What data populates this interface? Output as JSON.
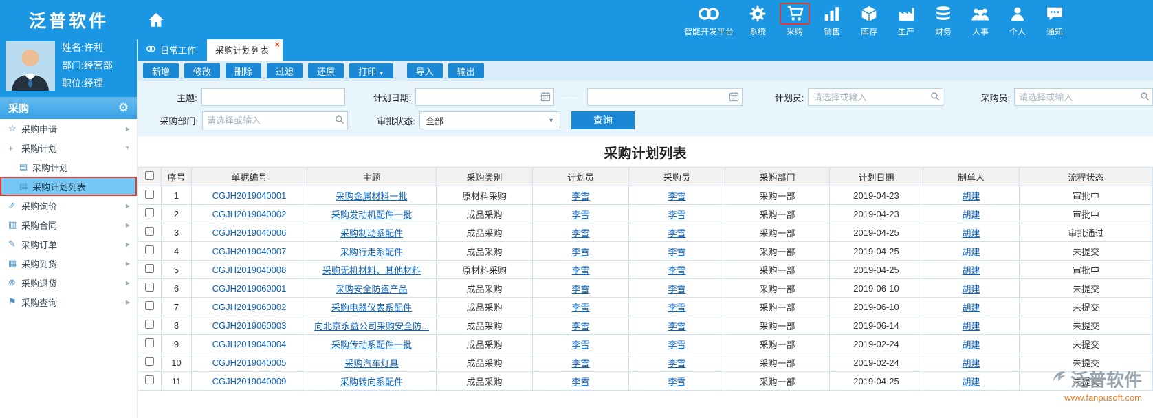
{
  "brand": {
    "logo": "泛普软件"
  },
  "topnav": {
    "items": [
      {
        "key": "dev-platform",
        "label": "智能开发平台",
        "icon": "infinity-icon",
        "highlighted": false
      },
      {
        "key": "system",
        "label": "系统",
        "icon": "gear-icon",
        "highlighted": false
      },
      {
        "key": "purchase",
        "label": "采购",
        "icon": "cart-icon",
        "highlighted": true
      },
      {
        "key": "sales",
        "label": "销售",
        "icon": "chart-icon",
        "highlighted": false
      },
      {
        "key": "inventory",
        "label": "库存",
        "icon": "inventory-icon",
        "highlighted": false
      },
      {
        "key": "production",
        "label": "生产",
        "icon": "production-icon",
        "highlighted": false
      },
      {
        "key": "finance",
        "label": "财务",
        "icon": "finance-icon",
        "highlighted": false
      },
      {
        "key": "hr",
        "label": "人事",
        "icon": "hr-icon",
        "highlighted": false
      },
      {
        "key": "personal",
        "label": "个人",
        "icon": "person-icon",
        "highlighted": false
      },
      {
        "key": "notification",
        "label": "通知",
        "icon": "notification-icon",
        "highlighted": false
      }
    ]
  },
  "profile": {
    "name": "姓名:许利",
    "department": "部门:经营部",
    "position": "职位:经理"
  },
  "sidebar": {
    "section_title": "采购",
    "items": [
      {
        "key": "purchase-request",
        "label": "采购申请",
        "icon": "star-icon",
        "level": 0,
        "arrow": "right",
        "selected": false
      },
      {
        "key": "purchase-plan",
        "label": "采购计划",
        "icon": "plus-icon",
        "level": 0,
        "arrow": "down",
        "selected": false
      },
      {
        "key": "purchase-plan-sub",
        "label": "采购计划",
        "icon": "file-icon",
        "level": 1,
        "arrow": "",
        "selected": false
      },
      {
        "key": "purchase-plan-list",
        "label": "采购计划列表",
        "icon": "file-icon",
        "level": 1,
        "arrow": "",
        "selected": true
      },
      {
        "key": "purchase-inquiry",
        "label": "采购询价",
        "icon": "share-icon",
        "level": 0,
        "arrow": "right",
        "selected": false
      },
      {
        "key": "purchase-contract",
        "label": "采购合同",
        "icon": "contract-icon",
        "level": 0,
        "arrow": "right",
        "selected": false
      },
      {
        "key": "purchase-order",
        "label": "采购订单",
        "icon": "order-icon",
        "level": 0,
        "arrow": "right",
        "selected": false
      },
      {
        "key": "purchase-arrival",
        "label": "采购到货",
        "icon": "arrival-icon",
        "level": 0,
        "arrow": "right",
        "selected": false
      },
      {
        "key": "purchase-return",
        "label": "采购退货",
        "icon": "return-icon",
        "level": 0,
        "arrow": "right",
        "selected": false
      },
      {
        "key": "purchase-query",
        "label": "采购查询",
        "icon": "query-icon",
        "level": 0,
        "arrow": "right",
        "selected": false
      }
    ]
  },
  "tabs": [
    {
      "key": "daily-work",
      "label": "日常工作",
      "icon": "link-icon",
      "active": false,
      "closable": false
    },
    {
      "key": "purchase-plan-list",
      "label": "采购计划列表",
      "icon": "",
      "active": true,
      "closable": true
    }
  ],
  "toolbar": {
    "buttons": [
      {
        "key": "add",
        "label": "新增"
      },
      {
        "key": "edit",
        "label": "修改"
      },
      {
        "key": "delete",
        "label": "删除"
      },
      {
        "key": "filter",
        "label": "过滤"
      },
      {
        "key": "restore",
        "label": "还原"
      },
      {
        "key": "print",
        "label": "打印",
        "caret": true
      },
      {
        "key": "import",
        "label": "导入",
        "gap": true
      },
      {
        "key": "export",
        "label": "输出"
      }
    ]
  },
  "filters": {
    "subject_label": "主题:",
    "plan_date_label": "计划日期:",
    "date_separator": "——",
    "planner_label": "计划员:",
    "buyer_label": "采购员:",
    "department_label": "采购部门:",
    "approval_label": "审批状态:",
    "approval_value": "全部",
    "select_placeholder": "请选择或输入",
    "search_button": "查询"
  },
  "grid": {
    "title": "采购计划列表",
    "columns": [
      "序号",
      "单据编号",
      "主题",
      "采购类别",
      "计划员",
      "采购员",
      "采购部门",
      "计划日期",
      "制单人",
      "流程状态"
    ],
    "rows": [
      [
        "1",
        "CGJH2019040001",
        "采购金属材料一批",
        "原材料采购",
        "李雪",
        "李雪",
        "采购一部",
        "2019-04-23",
        "胡建",
        "审批中"
      ],
      [
        "2",
        "CGJH2019040002",
        "采购发动机配件一批",
        "成品采购",
        "李雪",
        "李雪",
        "采购一部",
        "2019-04-23",
        "胡建",
        "审批中"
      ],
      [
        "3",
        "CGJH2019040006",
        "采购制动系配件",
        "成品采购",
        "李雪",
        "李雪",
        "采购一部",
        "2019-04-25",
        "胡建",
        "审批通过"
      ],
      [
        "4",
        "CGJH2019040007",
        "采购行走系配件",
        "成品采购",
        "李雪",
        "李雪",
        "采购一部",
        "2019-04-25",
        "胡建",
        "未提交"
      ],
      [
        "5",
        "CGJH2019040008",
        "采购无机材料、其他材料",
        "原材料采购",
        "李雪",
        "李雪",
        "采购一部",
        "2019-04-25",
        "胡建",
        "审批中"
      ],
      [
        "6",
        "CGJH2019060001",
        "采购安全防盗产品",
        "成品采购",
        "李雪",
        "李雪",
        "采购一部",
        "2019-06-10",
        "胡建",
        "未提交"
      ],
      [
        "7",
        "CGJH2019060002",
        "采购电器仪表系配件",
        "成品采购",
        "李雪",
        "李雪",
        "采购一部",
        "2019-06-10",
        "胡建",
        "未提交"
      ],
      [
        "8",
        "CGJH2019060003",
        "向北京永益公司采购安全防...",
        "成品采购",
        "李雪",
        "李雪",
        "采购一部",
        "2019-06-14",
        "胡建",
        "未提交"
      ],
      [
        "9",
        "CGJH2019040004",
        "采购传动系配件一批",
        "成品采购",
        "李雪",
        "李雪",
        "采购一部",
        "2019-02-24",
        "胡建",
        "未提交"
      ],
      [
        "10",
        "CGJH2019040005",
        "采购汽车灯具",
        "成品采购",
        "李雪",
        "李雪",
        "采购一部",
        "2019-02-24",
        "胡建",
        "未提交"
      ],
      [
        "11",
        "CGJH2019040009",
        "采购转向系配件",
        "成品采购",
        "李雪",
        "李雪",
        "采购一部",
        "2019-04-25",
        "胡建",
        "未提交"
      ]
    ]
  },
  "watermark": {
    "brand": "泛普软件",
    "url": "www.fanpusoft.com"
  },
  "colors": {
    "header_blue": "#1b96e3",
    "button_blue": "#1a88d4",
    "link_blue": "#0b62c1",
    "highlight_red": "#e8392a",
    "selected_menu_blue": "#76c7f4",
    "watermark_orange": "#e87a25"
  }
}
